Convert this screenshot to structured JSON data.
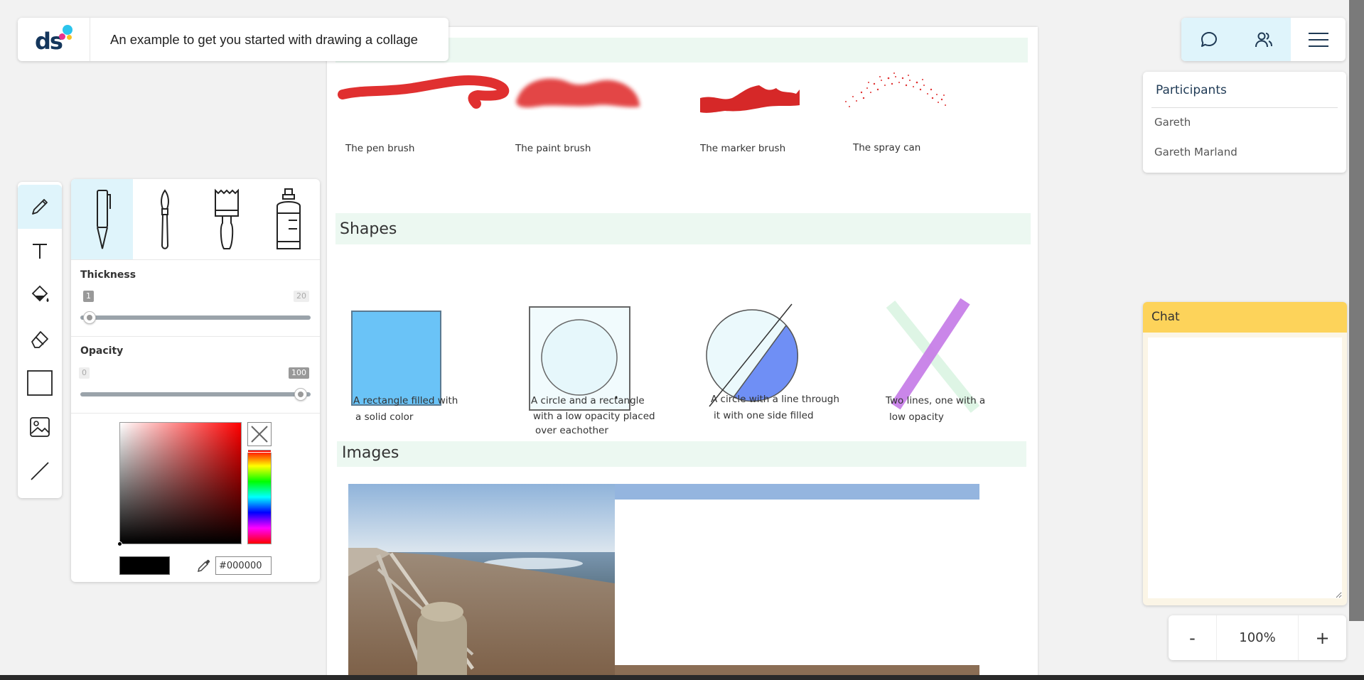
{
  "header": {
    "logo_text": "ds",
    "title": "An example to get you started with drawing a collage"
  },
  "toolbar": {
    "tools": [
      "pencil-icon",
      "text-icon",
      "fill-icon",
      "eraser-icon",
      "rectangle-icon",
      "image-icon",
      "line-icon"
    ],
    "active": "pencil-icon"
  },
  "brush_panel": {
    "brushes": [
      "pen-icon",
      "paintbrush-icon",
      "marker-icon",
      "spray-can-icon"
    ],
    "thickness": {
      "label": "Thickness",
      "min": "1",
      "max": "20",
      "value": 1
    },
    "opacity": {
      "label": "Opacity",
      "min": "0",
      "max": "100",
      "value": 100
    },
    "color_hex": "#000000",
    "hue_color": "#ff0000"
  },
  "canvas": {
    "brushes_section": {
      "captions": [
        "The pen brush",
        "The paint brush",
        "The marker brush",
        "The spray can"
      ],
      "stroke_color": "#e03030"
    },
    "shapes_section": {
      "title": "Shapes",
      "captions": [
        [
          "A rectangle filled with",
          "a solid color"
        ],
        [
          "A circle and a rectangle",
          "with a low opacity placed",
          "over eachother"
        ],
        [
          "A circle with a line through",
          "it with one side filled"
        ],
        [
          "Two lines, one with a",
          "low opacity"
        ]
      ],
      "colors": {
        "rect_fill": "#6ac3f7",
        "circle_half": "#6f8ff5",
        "purple_line": "#c880e8",
        "green_line": "#def5e5"
      }
    },
    "images_section": {
      "title": "Images"
    }
  },
  "top_buttons": [
    "chat-icon",
    "participants-icon",
    "menu-icon"
  ],
  "participants": {
    "title": "Participants",
    "items": [
      "Gareth",
      "Gareth Marland"
    ]
  },
  "chat": {
    "title": "Chat"
  },
  "zoom": {
    "minus": "-",
    "value": "100%",
    "plus": "+"
  }
}
